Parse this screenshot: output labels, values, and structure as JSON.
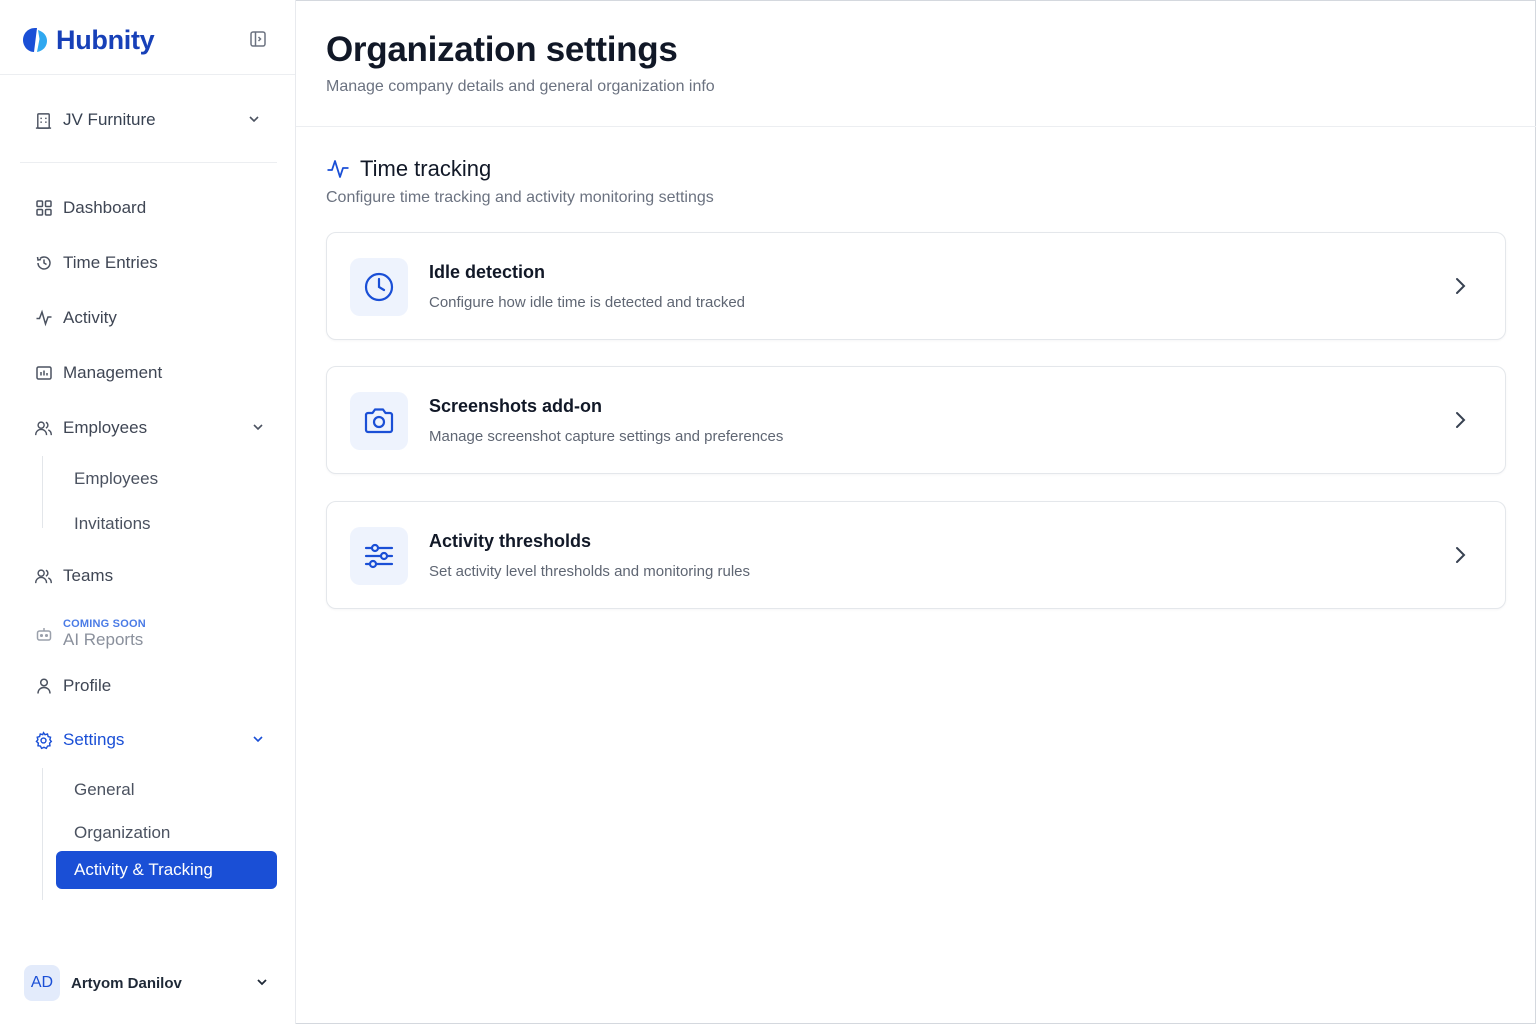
{
  "brand": {
    "name": "Hubnity",
    "color": "#1740b8"
  },
  "sidebar": {
    "org": {
      "name": "JV Furniture"
    },
    "items": [
      {
        "label": "Dashboard",
        "icon": "grid-icon"
      },
      {
        "label": "Time Entries",
        "icon": "history-icon"
      },
      {
        "label": "Activity",
        "icon": "activity-icon"
      },
      {
        "label": "Management",
        "icon": "chart-box-icon"
      },
      {
        "label": "Employees",
        "icon": "users-icon",
        "expanded": true
      },
      {
        "label": "Teams",
        "icon": "users-icon"
      },
      {
        "label": "Profile",
        "icon": "user-icon"
      },
      {
        "label": "Settings",
        "icon": "gear-icon",
        "expanded": true
      }
    ],
    "employees_sub": [
      "Employees",
      "Invitations"
    ],
    "ai_reports": {
      "tag": "COMING SOON",
      "label": "AI Reports"
    },
    "settings_sub": [
      "General",
      "Organization",
      "Activity & Tracking"
    ],
    "active_sub": "Activity & Tracking",
    "user": {
      "initials": "AD",
      "name": "Artyom Danilov"
    }
  },
  "main": {
    "title": "Organization settings",
    "subtitle": "Manage company details and general organization info",
    "section": {
      "title": "Time tracking",
      "description": "Configure time tracking and activity monitoring settings",
      "cards": [
        {
          "title": "Idle detection",
          "description": "Configure how idle time is detected and tracked",
          "icon": "clock-icon"
        },
        {
          "title": "Screenshots add-on",
          "description": "Manage screenshot capture settings and preferences",
          "icon": "camera-icon"
        },
        {
          "title": "Activity thresholds",
          "description": "Set activity level thresholds and monitoring rules",
          "icon": "sliders-icon"
        }
      ]
    }
  },
  "colors": {
    "accent": "#1a4fd6",
    "muted": "#6b7280",
    "border": "#e4e7eb"
  }
}
